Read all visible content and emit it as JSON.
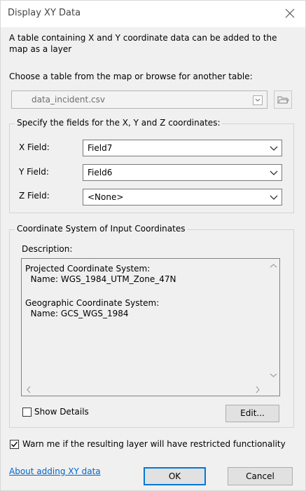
{
  "window": {
    "title": "Display XY Data"
  },
  "intro": {
    "line1": "A table containing X and Y coordinate data can be added to the",
    "line2": "map as a layer"
  },
  "table": {
    "label": "Choose a table from the map or browse for another table:",
    "value": "data_incident.csv"
  },
  "fields_group": {
    "legend": "Specify the fields for the X, Y and Z coordinates:",
    "x_label": "X Field:",
    "x_value": "Field7",
    "y_label": "Y Field:",
    "y_value": "Field6",
    "z_label": "Z Field:",
    "z_value": "<None>"
  },
  "crs_group": {
    "legend": "Coordinate System of Input Coordinates",
    "description_label": "Description:",
    "line1": "Projected Coordinate System:",
    "line2": "  Name: WGS_1984_UTM_Zone_47N",
    "line3": "Geographic Coordinate System:",
    "line4": "  Name: GCS_WGS_1984",
    "show_details_label": "Show Details",
    "show_details_checked": false,
    "edit_label": "Edit..."
  },
  "warn": {
    "label": "Warn me if the resulting layer will have restricted functionality",
    "checked": true
  },
  "footer": {
    "about_link": "About adding XY data",
    "ok_label": "OK",
    "cancel_label": "Cancel"
  },
  "colors": {
    "link": "#0066cc",
    "default_button_border": "#0078d7"
  }
}
